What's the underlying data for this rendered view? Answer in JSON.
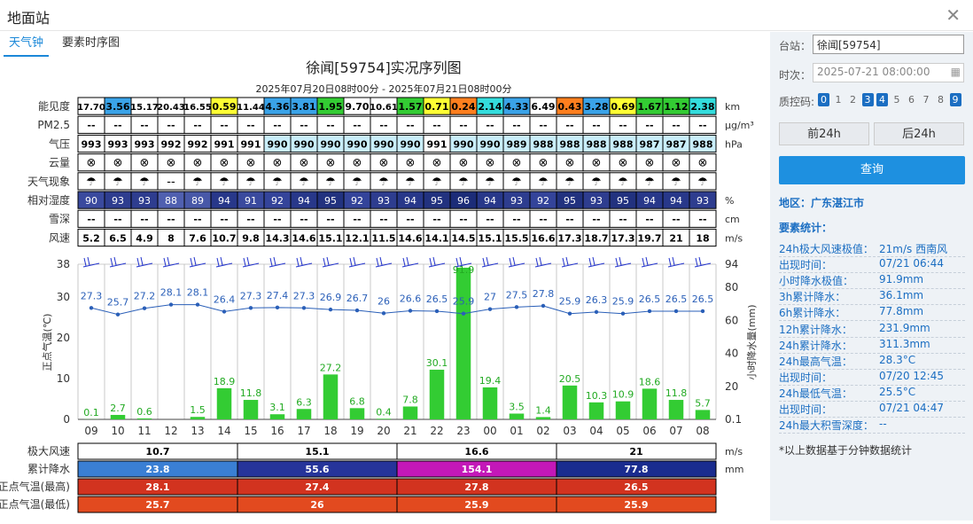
{
  "window": {
    "title": "地面站"
  },
  "tabs": [
    {
      "label": "天气钟"
    },
    {
      "label": "要素时序图"
    }
  ],
  "chart_header": {
    "title": "徐闻[59754]实况序列图",
    "subtitle": "2025年07月20日08时00分 - 2025年07月21日08时00分"
  },
  "table_rows": [
    {
      "label": "能见度",
      "unit": "km",
      "values": [
        "17.70",
        "3.56",
        "15.17",
        "20.43",
        "16.55",
        "0.59",
        "11.44",
        "4.36",
        "3.81",
        "1.95",
        "9.70",
        "10.61",
        "1.57",
        "0.71",
        "0.24",
        "2.14",
        "4.33",
        "6.49",
        "0.43",
        "3.28",
        "0.69",
        "1.67",
        "1.12",
        "2.38"
      ],
      "colors": [
        "#ffffff",
        "#3aa3e8",
        "#ffffff",
        "#ffffff",
        "#ffffff",
        "#ffff33",
        "#ffffff",
        "#3aa3e8",
        "#3aa3e8",
        "#33cc33",
        "#ffffff",
        "#ffffff",
        "#33cc33",
        "#ffff33",
        "#ff7f1e",
        "#33dddd",
        "#3aa3e8",
        "#ffffff",
        "#ff7f1e",
        "#3aa3e8",
        "#ffff33",
        "#33cc33",
        "#33cc33",
        "#33dddd"
      ]
    },
    {
      "label": "PM2.5",
      "unit": "μg/m³",
      "values": [
        "--",
        "--",
        "--",
        "--",
        "--",
        "--",
        "--",
        "--",
        "--",
        "--",
        "--",
        "--",
        "--",
        "--",
        "--",
        "--",
        "--",
        "--",
        "--",
        "--",
        "--",
        "--",
        "--",
        "--"
      ]
    },
    {
      "label": "气压",
      "unit": "hPa",
      "values": [
        "993",
        "993",
        "993",
        "992",
        "992",
        "991",
        "991",
        "990",
        "990",
        "990",
        "990",
        "990",
        "990",
        "991",
        "990",
        "990",
        "989",
        "988",
        "988",
        "988",
        "988",
        "987",
        "987",
        "988"
      ],
      "colors": [
        "#ffffff",
        "#ffffff",
        "#ffffff",
        "#ffffff",
        "#ffffff",
        "#ffffff",
        "#ffffff",
        "#c9eefa",
        "#c9eefa",
        "#c9eefa",
        "#c9eefa",
        "#c9eefa",
        "#c9eefa",
        "#ffffff",
        "#c9eefa",
        "#c9eefa",
        "#c9eefa",
        "#c9eefa",
        "#c9eefa",
        "#c9eefa",
        "#c9eefa",
        "#c9eefa",
        "#c9eefa",
        "#c9eefa"
      ]
    },
    {
      "label": "云量",
      "unit": "",
      "values": [
        "⊗",
        "⊗",
        "⊗",
        "⊗",
        "⊗",
        "⊗",
        "⊗",
        "⊗",
        "⊗",
        "⊗",
        "⊗",
        "⊗",
        "⊗",
        "⊗",
        "⊗",
        "⊗",
        "⊗",
        "⊗",
        "⊗",
        "⊗",
        "⊗",
        "⊗",
        "⊗",
        "⊗"
      ]
    },
    {
      "label": "天气现象",
      "unit": "",
      "values": [
        "☂",
        "☂",
        "☂",
        "--",
        "☂",
        "☂",
        "☂",
        "☂",
        "☂",
        "☂",
        "☂",
        "☂",
        "☂",
        "☂",
        "☂",
        "☂",
        "☂",
        "☂",
        "☂",
        "☂",
        "☂",
        "☂",
        "☂",
        "☂"
      ]
    },
    {
      "label": "相对湿度",
      "unit": "%",
      "values": [
        "90",
        "93",
        "93",
        "88",
        "89",
        "94",
        "91",
        "92",
        "94",
        "95",
        "92",
        "93",
        "94",
        "95",
        "96",
        "94",
        "93",
        "92",
        "95",
        "93",
        "95",
        "94",
        "94",
        "93"
      ],
      "colors": [
        "#3a4a9e",
        "#2e3d8f",
        "#2e3d8f",
        "#5060b0",
        "#4858a8",
        "#28388a",
        "#3a4a9e",
        "#34449a",
        "#28388a",
        "#22327f",
        "#34449a",
        "#2e3d8f",
        "#28388a",
        "#22327f",
        "#1c2c78",
        "#28388a",
        "#2e3d8f",
        "#34449a",
        "#22327f",
        "#2e3d8f",
        "#22327f",
        "#28388a",
        "#28388a",
        "#2e3d8f"
      ]
    },
    {
      "label": "雪深",
      "unit": "cm",
      "values": [
        "--",
        "--",
        "--",
        "--",
        "--",
        "--",
        "--",
        "--",
        "--",
        "--",
        "--",
        "--",
        "--",
        "--",
        "--",
        "--",
        "--",
        "--",
        "--",
        "--",
        "--",
        "--",
        "--",
        "--"
      ]
    },
    {
      "label": "风速",
      "unit": "m/s",
      "values": [
        "5.2",
        "6.5",
        "4.9",
        "8",
        "7.6",
        "10.7",
        "9.8",
        "14.3",
        "14.6",
        "15.1",
        "12.1",
        "11.5",
        "14.6",
        "14.1",
        "14.5",
        "15.1",
        "15.5",
        "16.6",
        "17.3",
        "18.7",
        "17.3",
        "19.7",
        "21",
        "18"
      ]
    }
  ],
  "chart_data": {
    "type": "bar",
    "hours": [
      "09",
      "10",
      "11",
      "12",
      "13",
      "14",
      "15",
      "16",
      "17",
      "18",
      "19",
      "20",
      "21",
      "22",
      "23",
      "00",
      "01",
      "02",
      "03",
      "04",
      "05",
      "06",
      "07",
      "08"
    ],
    "series": [
      {
        "values": [
          27.3,
          25.7,
          27.2,
          28.1,
          28.1,
          26.4,
          27.3,
          27.4,
          27.3,
          26.9,
          26.7,
          26,
          26.6,
          26.5,
          25.9,
          27,
          27.5,
          27.8,
          25.9,
          26.3,
          25.9,
          26.5,
          26.5,
          26.5
        ],
        "color": "#2a5fb8"
      },
      {
        "values": [
          0.1,
          2.7,
          0.6,
          0,
          1.5,
          18.9,
          11.8,
          3.1,
          6.3,
          27.2,
          6.8,
          0.4,
          7.8,
          30.1,
          91.9,
          19.4,
          3.5,
          1.4,
          20.5,
          10.3,
          10.9,
          18.6,
          11.8,
          5.7
        ],
        "color": "#33cc33",
        "labels": [
          "0.1",
          "2.7",
          "0.6",
          "",
          "1.5",
          "18.9",
          "11.8",
          "3.1",
          "6.3",
          "27.2",
          "6.8",
          "0.4",
          "7.8",
          "30.1",
          "91.9",
          "19.4",
          "3.5",
          "1.4",
          "20.5",
          "10.3",
          "10.9",
          "18.6",
          "11.8",
          "5.7"
        ]
      }
    ],
    "left_axis": {
      "label": "正点气温(℃)",
      "ticks": [
        "0",
        "10",
        "20",
        "30",
        "38"
      ],
      "range": [
        0,
        38
      ]
    },
    "right_axis": {
      "label": "小时降水量(mm)",
      "ticks": [
        "0.1",
        "20",
        "40",
        "60",
        "80",
        "94"
      ],
      "range": [
        0,
        94
      ]
    },
    "grid": true
  },
  "summary": {
    "rows": [
      {
        "label": "极大风速",
        "unit": "m/s",
        "values": [
          "10.7",
          "15.1",
          "16.6",
          "21"
        ],
        "colors": [
          "#ffffff",
          "#ffffff",
          "#ffffff",
          "#ffffff"
        ],
        "text_color": "#000000"
      },
      {
        "label": "累计降水",
        "unit": "mm",
        "values": [
          "23.8",
          "55.6",
          "154.1",
          "77.8"
        ],
        "colors": [
          "#3a7fd4",
          "#26349a",
          "#c318b8",
          "#1a2c8f"
        ],
        "text_color": "#ffffff"
      },
      {
        "label": "正点气温(最高)",
        "unit": "",
        "values": [
          "28.1",
          "27.4",
          "27.8",
          "26.5"
        ],
        "colors": [
          "#d2331f",
          "#d2331f",
          "#d2331f",
          "#d2331f"
        ],
        "text_color": "#ffffff"
      },
      {
        "label": "正点气温(最低)",
        "unit": "",
        "values": [
          "25.7",
          "26",
          "25.9",
          "25.9"
        ],
        "colors": [
          "#e24a1f",
          "#e24a1f",
          "#e24a1f",
          "#e24a1f"
        ],
        "text_color": "#ffffff"
      }
    ]
  },
  "sidebar": {
    "station_label": "台站：",
    "station_value": "徐闻[59754]",
    "time_label": "时次：",
    "time_value": "2025-07-21 08:00:00",
    "qc_label": "质控码:",
    "qc_codes": [
      "0",
      "1",
      "2",
      "3",
      "4",
      "5",
      "6",
      "7",
      "8",
      "9"
    ],
    "qc_selected": [
      true,
      false,
      false,
      true,
      true,
      false,
      false,
      false,
      false,
      true
    ],
    "prev_label": "前24h",
    "next_label": "后24h",
    "query_label": "查询",
    "region_label": "地区：广东湛江市",
    "stats_title": "要素统计：",
    "stats": [
      {
        "k": "24h极大风速极值：",
        "v": "21m/s 西南风"
      },
      {
        "k": "出现时间：",
        "v": "07/21 06:44"
      },
      {
        "k": "小时降水极值：",
        "v": "91.9mm"
      },
      {
        "k": "3h累计降水：",
        "v": "36.1mm"
      },
      {
        "k": "6h累计降水：",
        "v": "77.8mm"
      },
      {
        "k": "12h累计降水：",
        "v": "231.9mm"
      },
      {
        "k": "24h累计降水：",
        "v": "311.3mm"
      },
      {
        "k": "24h最高气温：",
        "v": "28.3°C"
      },
      {
        "k": "出现时间：",
        "v": "07/20 12:45"
      },
      {
        "k": "24h最低气温：",
        "v": "25.5°C"
      },
      {
        "k": "出现时间：",
        "v": "07/21 04:47"
      },
      {
        "k": "24h最大积雪深度：",
        "v": "--"
      }
    ],
    "note": "*以上数据基于分钟数据统计"
  }
}
